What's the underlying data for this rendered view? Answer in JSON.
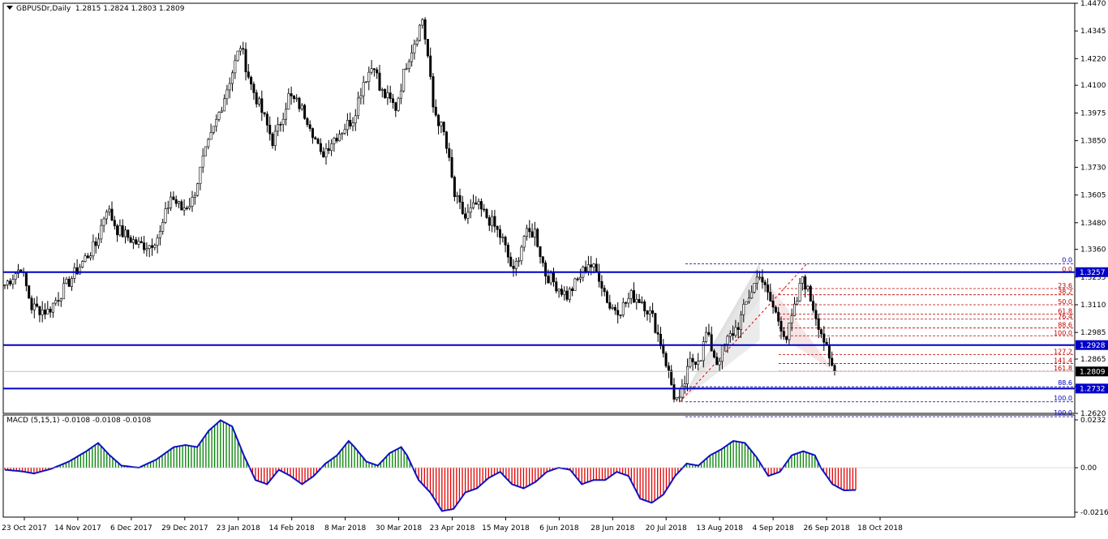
{
  "window": {
    "symbol": "GBPUSDr,Daily",
    "ohlc": "1.2815 1.2824 1.2803 1.2809",
    "macd_label": "MACD (5,15,1) -0.0108 -0.0108 -0.0108"
  },
  "price_axis": {
    "ticks": [
      "1.4470",
      "1.4345",
      "1.4220",
      "1.4100",
      "1.3975",
      "1.3850",
      "1.3730",
      "1.3605",
      "1.3480",
      "1.3360",
      "1.3235",
      "1.3110",
      "1.2985",
      "1.2865",
      "1.2740",
      "1.2620"
    ],
    "min": 1.262,
    "max": 1.447
  },
  "levels": [
    {
      "value": 1.3257,
      "label": "1.3257"
    },
    {
      "value": 1.2928,
      "label": "1.2928"
    },
    {
      "value": 1.2732,
      "label": "1.2732"
    }
  ],
  "current_price": {
    "value": 1.2809,
    "label": "1.2809"
  },
  "macd_axis": {
    "ticks": [
      "0.0232",
      "0.00",
      "-0.0216"
    ],
    "min": -0.0216,
    "max": 0.0232
  },
  "fibo": {
    "blue_labels": [
      {
        "value": 1.3295,
        "label": "0.0"
      },
      {
        "value": 1.2672,
        "label": "100.0"
      },
      {
        "value": 1.2605,
        "label": "100.0"
      },
      {
        "value": 1.274,
        "label": "88.6"
      }
    ],
    "red_labels": [
      {
        "value": 1.3257,
        "label": "0.0"
      },
      {
        "value": 1.3183,
        "label": "23.6"
      },
      {
        "value": 1.3155,
        "label": "38.2"
      },
      {
        "value": 1.311,
        "label": "50.0"
      },
      {
        "value": 1.3068,
        "label": "61.8"
      },
      {
        "value": 1.3045,
        "label": "76.4"
      },
      {
        "value": 1.3005,
        "label": "88.6"
      },
      {
        "value": 1.297,
        "label": "100.0"
      },
      {
        "value": 1.2885,
        "label": "127.2"
      },
      {
        "value": 1.2845,
        "label": "141.4"
      },
      {
        "value": 1.281,
        "label": "161.8"
      }
    ]
  },
  "time_axis": [
    "23 Oct 2017",
    "14 Nov 2017",
    "6 Dec 2017",
    "29 Dec 2017",
    "23 Jan 2018",
    "14 Feb 2018",
    "8 Mar 2018",
    "30 Mar 2018",
    "23 Apr 2018",
    "15 May 2018",
    "6 Jun 2018",
    "28 Jun 2018",
    "20 Jul 2018",
    "13 Aug 2018",
    "4 Sep 2018",
    "26 Sep 2018",
    "18 Oct 2018"
  ],
  "chart_data": {
    "type": "candlestick",
    "anchors": [
      [
        0,
        1.32
      ],
      [
        6,
        1.328
      ],
      [
        10,
        1.31
      ],
      [
        16,
        1.308
      ],
      [
        22,
        1.318
      ],
      [
        30,
        1.332
      ],
      [
        34,
        1.338
      ],
      [
        38,
        1.355
      ],
      [
        42,
        1.345
      ],
      [
        50,
        1.338
      ],
      [
        54,
        1.338
      ],
      [
        58,
        1.343
      ],
      [
        62,
        1.36
      ],
      [
        66,
        1.354
      ],
      [
        70,
        1.358
      ],
      [
        74,
        1.376
      ],
      [
        78,
        1.39
      ],
      [
        82,
        1.405
      ],
      [
        86,
        1.42
      ],
      [
        88,
        1.428
      ],
      [
        92,
        1.41
      ],
      [
        96,
        1.398
      ],
      [
        100,
        1.385
      ],
      [
        102,
        1.39
      ],
      [
        106,
        1.405
      ],
      [
        110,
        1.401
      ],
      [
        114,
        1.393
      ],
      [
        118,
        1.378
      ],
      [
        122,
        1.385
      ],
      [
        126,
        1.39
      ],
      [
        130,
        1.395
      ],
      [
        134,
        1.412
      ],
      [
        138,
        1.42
      ],
      [
        140,
        1.408
      ],
      [
        146,
        1.4
      ],
      [
        150,
        1.42
      ],
      [
        154,
        1.433
      ],
      [
        156,
        1.44
      ],
      [
        158,
        1.423
      ],
      [
        160,
        1.4
      ],
      [
        164,
        1.388
      ],
      [
        166,
        1.375
      ],
      [
        168,
        1.36
      ],
      [
        172,
        1.35
      ],
      [
        176,
        1.356
      ],
      [
        182,
        1.348
      ],
      [
        186,
        1.34
      ],
      [
        190,
        1.325
      ],
      [
        194,
        1.342
      ],
      [
        198,
        1.344
      ],
      [
        202,
        1.325
      ],
      [
        206,
        1.32
      ],
      [
        210,
        1.315
      ],
      [
        214,
        1.322
      ],
      [
        218,
        1.33
      ],
      [
        222,
        1.324
      ],
      [
        226,
        1.31
      ],
      [
        230,
        1.309
      ],
      [
        234,
        1.315
      ],
      [
        238,
        1.313
      ],
      [
        242,
        1.305
      ],
      [
        246,
        1.29
      ],
      [
        250,
        1.27
      ],
      [
        252,
        1.267
      ],
      [
        254,
        1.276
      ],
      [
        256,
        1.285
      ],
      [
        260,
        1.288
      ],
      [
        262,
        1.298
      ],
      [
        266,
        1.285
      ],
      [
        270,
        1.295
      ],
      [
        274,
        1.302
      ],
      [
        278,
        1.315
      ],
      [
        282,
        1.3257
      ],
      [
        284,
        1.318
      ],
      [
        288,
        1.307
      ],
      [
        292,
        1.296
      ],
      [
        296,
        1.313
      ],
      [
        298,
        1.324
      ],
      [
        302,
        1.31
      ],
      [
        306,
        1.295
      ],
      [
        308,
        1.285
      ],
      [
        310,
        1.2809
      ]
    ],
    "macd": [
      [
        0,
        -0.001
      ],
      [
        6,
        -0.0018
      ],
      [
        10,
        -0.0028
      ],
      [
        16,
        -0.0005
      ],
      [
        22,
        0.003
      ],
      [
        28,
        0.008
      ],
      [
        32,
        0.012
      ],
      [
        36,
        0.006
      ],
      [
        40,
        0.001
      ],
      [
        46,
        0.0
      ],
      [
        52,
        0.004
      ],
      [
        58,
        0.01
      ],
      [
        62,
        0.011
      ],
      [
        66,
        0.01
      ],
      [
        70,
        0.018
      ],
      [
        74,
        0.023
      ],
      [
        78,
        0.02
      ],
      [
        82,
        0.006
      ],
      [
        86,
        -0.006
      ],
      [
        90,
        -0.008
      ],
      [
        94,
        -0.001
      ],
      [
        98,
        -0.004
      ],
      [
        102,
        -0.008
      ],
      [
        106,
        -0.004
      ],
      [
        110,
        0.002
      ],
      [
        114,
        0.006
      ],
      [
        118,
        0.013
      ],
      [
        120,
        0.01
      ],
      [
        124,
        0.003
      ],
      [
        128,
        0.001
      ],
      [
        132,
        0.007
      ],
      [
        136,
        0.01
      ],
      [
        138,
        0.006
      ],
      [
        142,
        -0.006
      ],
      [
        146,
        -0.012
      ],
      [
        150,
        -0.021
      ],
      [
        154,
        -0.02
      ],
      [
        158,
        -0.012
      ],
      [
        162,
        -0.01
      ],
      [
        166,
        -0.005
      ],
      [
        170,
        -0.002
      ],
      [
        174,
        -0.008
      ],
      [
        178,
        -0.01
      ],
      [
        182,
        -0.007
      ],
      [
        186,
        -0.002
      ],
      [
        190,
        0.0
      ],
      [
        194,
        -0.001
      ],
      [
        198,
        -0.008
      ],
      [
        202,
        -0.006
      ],
      [
        206,
        -0.006
      ],
      [
        210,
        -0.002
      ],
      [
        214,
        -0.004
      ],
      [
        218,
        -0.015
      ],
      [
        222,
        -0.017
      ],
      [
        226,
        -0.013
      ],
      [
        230,
        -0.004
      ],
      [
        234,
        0.002
      ],
      [
        238,
        0.001
      ],
      [
        242,
        0.006
      ],
      [
        246,
        0.009
      ],
      [
        250,
        0.013
      ],
      [
        254,
        0.012
      ],
      [
        258,
        0.005
      ],
      [
        262,
        -0.004
      ],
      [
        266,
        -0.002
      ],
      [
        270,
        0.006
      ],
      [
        274,
        0.008
      ],
      [
        278,
        0.006
      ],
      [
        280,
        0.0
      ],
      [
        284,
        -0.008
      ],
      [
        288,
        -0.011
      ],
      [
        292,
        -0.0108
      ]
    ]
  }
}
